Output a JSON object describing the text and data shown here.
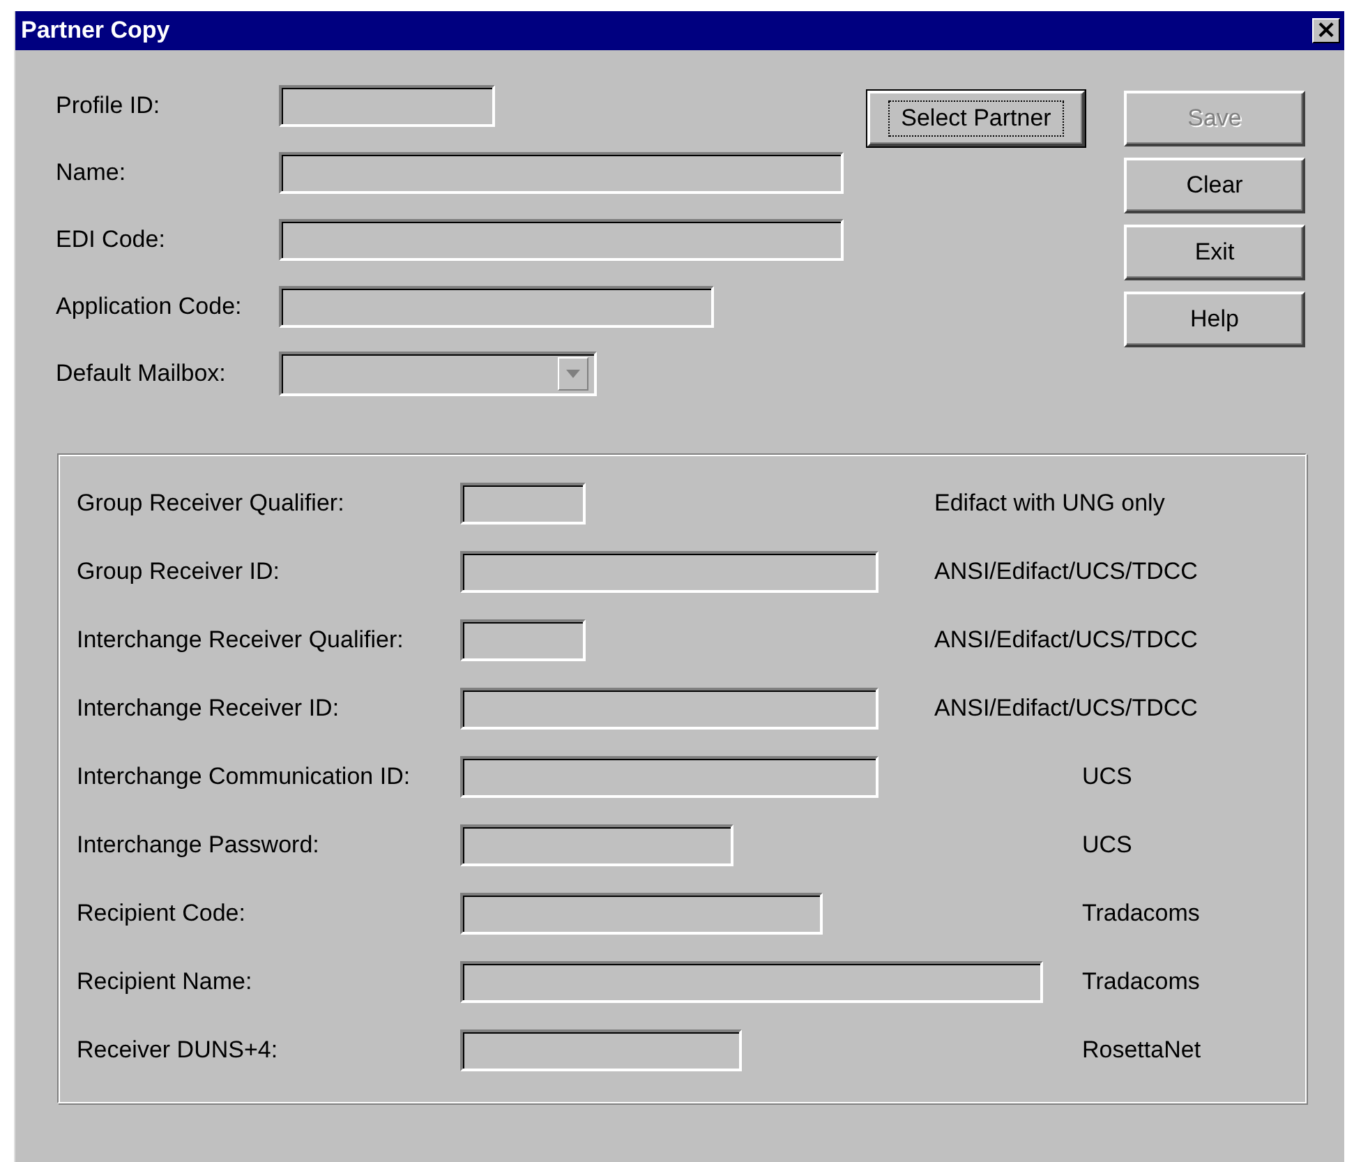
{
  "window": {
    "title": "Partner Copy",
    "close_button": "×"
  },
  "fields": [
    {
      "label": "Profile ID:",
      "kind": "text"
    },
    {
      "label": "Name:",
      "kind": "text"
    },
    {
      "label": "EDI Code:",
      "kind": "text"
    },
    {
      "label": "Application Code:",
      "kind": "text"
    },
    {
      "label": "Default Mailbox:",
      "kind": "dropdown"
    }
  ],
  "select_button": {
    "label": "Select Partner",
    "focused": true
  },
  "buttons": [
    {
      "label": "Save",
      "disabled": true
    },
    {
      "label": "Clear",
      "disabled": false
    },
    {
      "label": "Exit",
      "disabled": false
    },
    {
      "label": "Help",
      "disabled": false
    }
  ],
  "receiver_fields": [
    {
      "label": "Group Receiver Qualifier:",
      "note": "Edifact with UNG only"
    },
    {
      "label": "Group Receiver ID:",
      "note": "ANSI/Edifact/UCS/TDCC"
    },
    {
      "label": "Interchange Receiver Qualifier:",
      "note": "ANSI/Edifact/UCS/TDCC"
    },
    {
      "label": "Interchange Receiver ID:",
      "note": "ANSI/Edifact/UCS/TDCC"
    },
    {
      "label": "Interchange Communication ID:",
      "note": "UCS"
    },
    {
      "label": "Interchange Password:",
      "note": "UCS"
    },
    {
      "label": "Recipient Code:",
      "note": "Tradacoms"
    },
    {
      "label": "Recipient Name:",
      "note": "Tradacoms"
    },
    {
      "label": "Receiver DUNS+4:",
      "note": "RosettaNet"
    }
  ]
}
